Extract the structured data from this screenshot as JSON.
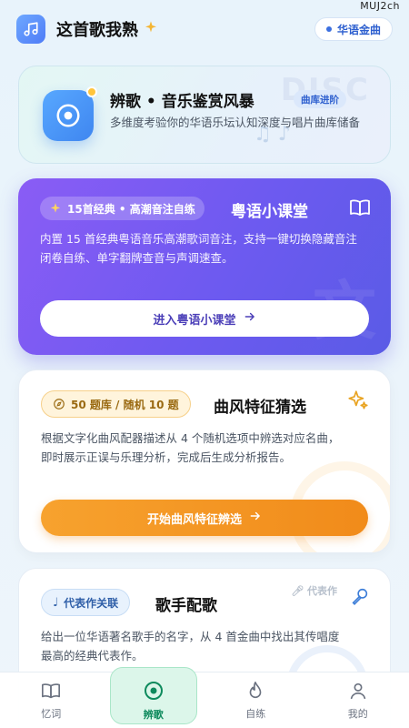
{
  "watermark": "MUJ2ch",
  "header": {
    "app_title": "这首歌我熟",
    "region_pill": "华语金曲"
  },
  "hero": {
    "title": "辨歌 • 音乐鉴赏风暴",
    "tag": "曲库进阶",
    "description": "多维度考验你的华语乐坛认知深度与唱片曲库储备",
    "bg_word": "DISC"
  },
  "cantonese_card": {
    "badge": "15首经典 • 高潮音注自练",
    "title": "粤语小课堂",
    "description": "内置 15 首经典粤语音乐高潮歌词音注，支持一键切换隐藏音注闭卷自练、单字翻牌查音与声调速查。",
    "button_label": "进入粤语小课堂",
    "bg_deco": "文"
  },
  "style_card": {
    "badge": "50 题库 / 随机 10 题",
    "title": "曲风特征猜选",
    "description": "根据文字化曲风配器描述从 4 个随机选项中辨选对应名曲，即时展示正误与乐理分析，完成后生成分析报告。",
    "button_label": "开始曲风特征辨选"
  },
  "singer_card": {
    "badge": "代表作关联",
    "title": "歌手配歌",
    "tag": "代表作",
    "description": "给出一位华语著名歌手的名字，从 4 首金曲中找出其传唱度最高的经典代表作。"
  },
  "bottom_nav": [
    {
      "label": "忆词",
      "icon": "book-icon",
      "active": false
    },
    {
      "label": "辨歌",
      "icon": "disc-icon",
      "active": true
    },
    {
      "label": "自练",
      "icon": "flame-icon",
      "active": false
    },
    {
      "label": "我的",
      "icon": "user-icon",
      "active": false
    }
  ],
  "colors": {
    "accent_blue": "#3f86f0",
    "purple": "#6d5af0",
    "orange": "#f18b1a",
    "active_green": "#0e8a5d"
  }
}
